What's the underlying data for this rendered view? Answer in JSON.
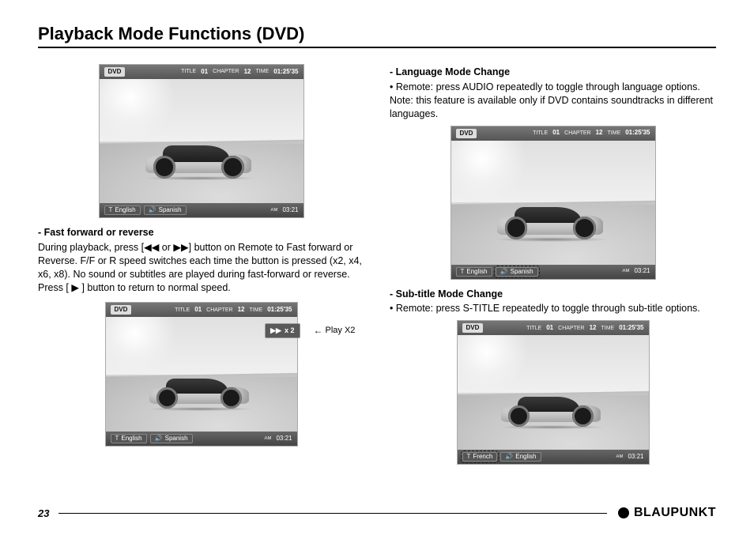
{
  "page": {
    "title": "Playback Mode Functions (DVD)",
    "number": "23",
    "brand": "BLAUPUNKT"
  },
  "osd": {
    "dvd_label": "DVD",
    "title_lbl": "TITLE",
    "title_val": "01",
    "chapter_lbl": "CHAPTER",
    "chapter_val": "12",
    "time_lbl": "TIME",
    "time_val": "01:25'35",
    "ampm": "AM",
    "clock": "03:21",
    "t_icon": "T",
    "spk_icon": "🔊",
    "lang_sub_en": "English",
    "lang_audio_sp": "Spanish",
    "lang_sub_fr": "French",
    "lang_audio_en": "English"
  },
  "left": {
    "h1": "- Fast forward or reverse",
    "p1a": "During playback, press [",
    "p1_rw": "◀◀",
    "p1_or": " or ",
    "p1_ff": "▶▶",
    "p1b": "] button on Remote to Fast forward or Reverse.  F/F or R speed switches each time the button is pressed (x2, x4, x6, x8).  No sound or subtitles are played during fast-forward or reverse.",
    "p2a": "Press [ ",
    "p2_play": "▶",
    "p2b": " ]  button to return to normal speed.",
    "badge_icon": "▶▶",
    "badge_text": "x 2",
    "badge_note": "Play X2"
  },
  "right": {
    "h1": "- Language Mode Change",
    "p1": "• Remote: press AUDIO repeatedly to toggle through language options. Note: this feature is available only if DVD contains soundtracks in different languages.",
    "h2": "- Sub-title Mode Change",
    "p2": "• Remote: press S-TITLE repeatedly to toggle through sub-title options."
  }
}
